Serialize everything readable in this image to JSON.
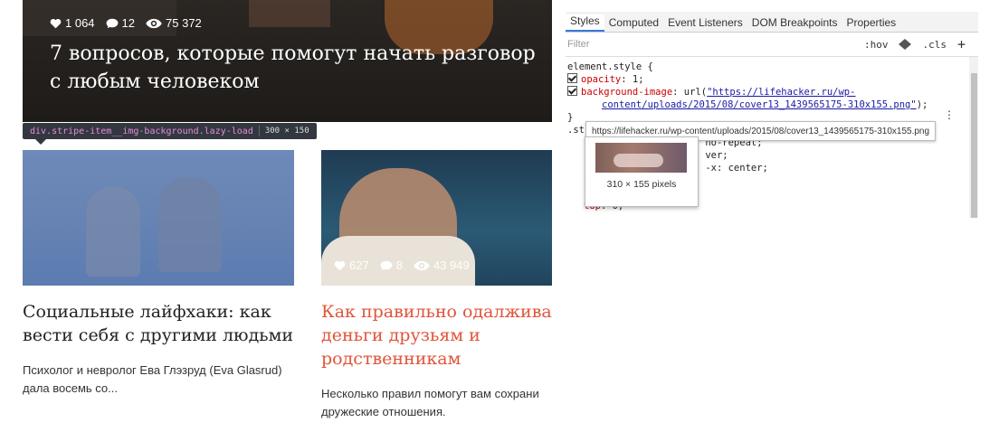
{
  "hero": {
    "likes": "1 064",
    "comments": "12",
    "views": "75 372",
    "title_line1": "7 вопросов, которые помогут начать разговор",
    "title_line2": "с любым человеком"
  },
  "inspector_tooltip": {
    "selector": "div.stripe-item__img-background.lazy-load",
    "dims": "300 × 150"
  },
  "cards": [
    {
      "title": "Социальные лайфхаки: как вести себя с другими людьми",
      "desc": "Психолог и невролог Ева Глэзруд (Eva Glasrud) дала восемь со..."
    },
    {
      "likes": "627",
      "comments": "8",
      "views": "43 949",
      "title_l1": "Как правильно одалжива",
      "title_l2": "деньги друзьям и",
      "title_l3": "родственникам",
      "desc_l1": "Несколько правил помогут вам сохрани",
      "desc_l2": "дружеские отношения."
    }
  ],
  "devtools": {
    "tabs": [
      "Styles",
      "Computed",
      "Event Listeners",
      "DOM Breakpoints",
      "Properties"
    ],
    "filter_placeholder": "Filter",
    "hov": ":hov",
    "cls": ".cls",
    "plus": "+",
    "rule_selector": "element.style {",
    "opacity_prop": "opacity",
    "opacity_val": ": 1;",
    "bg_prop": "background-image",
    "bg_val_prefix": ": url(",
    "bg_url_1": "\"https://lifehacker.ru/wp-",
    "bg_url_2": "content/uploads/2015/08/cover13_1439565175-310x155.png\"",
    "bg_val_suffix": ");",
    "close_brace": "}",
    "next_selector_start": ".st",
    "frag1_prefix": "b",
    "frag1_rest": "no-repeat;",
    "frag2_prefix": "b",
    "frag2_rest": "ver;",
    "frag3_prefix": "b",
    "frag3_rest": "-x: center;",
    "frag4": "p",
    "frag5": "l",
    "top_prop": "top",
    "top_val": ": 0;",
    "url_tooltip": "https://lifehacker.ru/wp-content/uploads/2015/08/cover13_1439565175-310x155.png",
    "image_size": "310 × 155 pixels"
  }
}
